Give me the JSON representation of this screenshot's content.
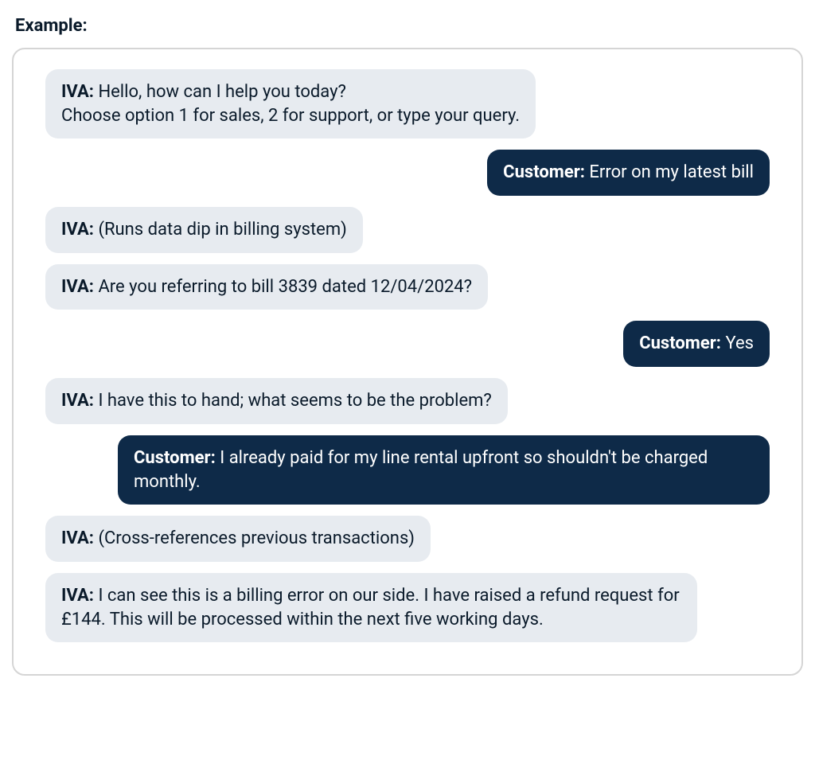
{
  "heading": "Example:",
  "labels": {
    "iva": "IVA:",
    "customer": "Customer:"
  },
  "messages": [
    {
      "side": "left",
      "speaker": "iva",
      "text": " Hello, how can I help you today?",
      "extra": "Choose option 1 for sales, 2 for support, or type your query."
    },
    {
      "side": "right",
      "speaker": "customer",
      "text": " Error on my latest bill"
    },
    {
      "side": "left",
      "speaker": "iva",
      "text": " (Runs data dip in billing system)"
    },
    {
      "side": "left",
      "speaker": "iva",
      "text": " Are you referring to bill 3839 dated 12/04/2024?"
    },
    {
      "side": "right",
      "speaker": "customer",
      "text": " Yes"
    },
    {
      "side": "left",
      "speaker": "iva",
      "text": " I have this to hand; what seems to be the problem?"
    },
    {
      "side": "right",
      "speaker": "customer",
      "text": " I already paid for my line rental upfront so shouldn't be charged monthly."
    },
    {
      "side": "left",
      "speaker": "iva",
      "text": " (Cross-references previous transactions)"
    },
    {
      "side": "left",
      "speaker": "iva",
      "text": " I can see this is a billing error on our side. I have raised a refund request for £144. This will be processed within the next five working days."
    }
  ]
}
